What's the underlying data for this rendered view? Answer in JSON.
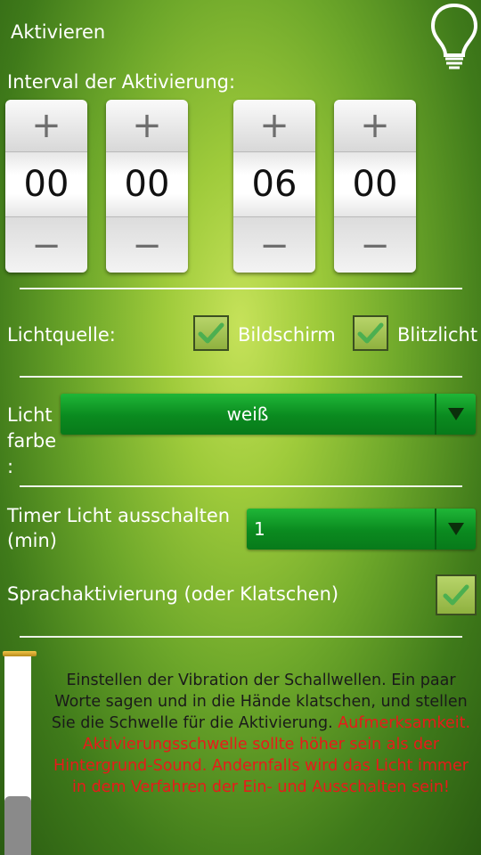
{
  "header": {
    "title": "Aktivieren",
    "icon": "lightbulb-icon"
  },
  "interval": {
    "label": "Interval der Aktivierung:",
    "spinners": [
      {
        "value": "00",
        "plus": "+",
        "minus": "−"
      },
      {
        "value": "00",
        "plus": "+",
        "minus": "−"
      },
      {
        "value": "06",
        "plus": "+",
        "minus": "−"
      },
      {
        "value": "00",
        "plus": "+",
        "minus": "−"
      }
    ]
  },
  "light_source": {
    "label": "Lichtquelle:",
    "options": [
      {
        "label": "Bildschirm",
        "checked": true
      },
      {
        "label": "Blitzlicht",
        "checked": true
      }
    ]
  },
  "light_color": {
    "label_line1": "Licht",
    "label_line2": "farbe",
    "label_line3": ":",
    "value": "weiß"
  },
  "timer": {
    "label_line1": "Timer Licht ausschalten",
    "label_line2": "(min)",
    "value": "1"
  },
  "voice": {
    "label": "Sprachaktivierung (oder Klatschen)",
    "checked": true
  },
  "sensitivity": {
    "level": 0.29
  },
  "info": {
    "normal": "Einstellen der Vibration der Schallwellen. Ein paar Worte sagen und in die Hände klatschen, und stellen Sie die Schwelle für die Aktivierung.",
    "warning": "Aufmerksamkeit. Aktivierungsschwelle sollte höher sein als der Hintergrund-Sound. Andernfalls wird das Licht immer in dem Verfahren der Ein- und Ausschalten sein!"
  },
  "colors": {
    "dropdown_green": "#0a8a1f",
    "warning_red": "#e81a1a",
    "check_green": "#4caf50"
  }
}
